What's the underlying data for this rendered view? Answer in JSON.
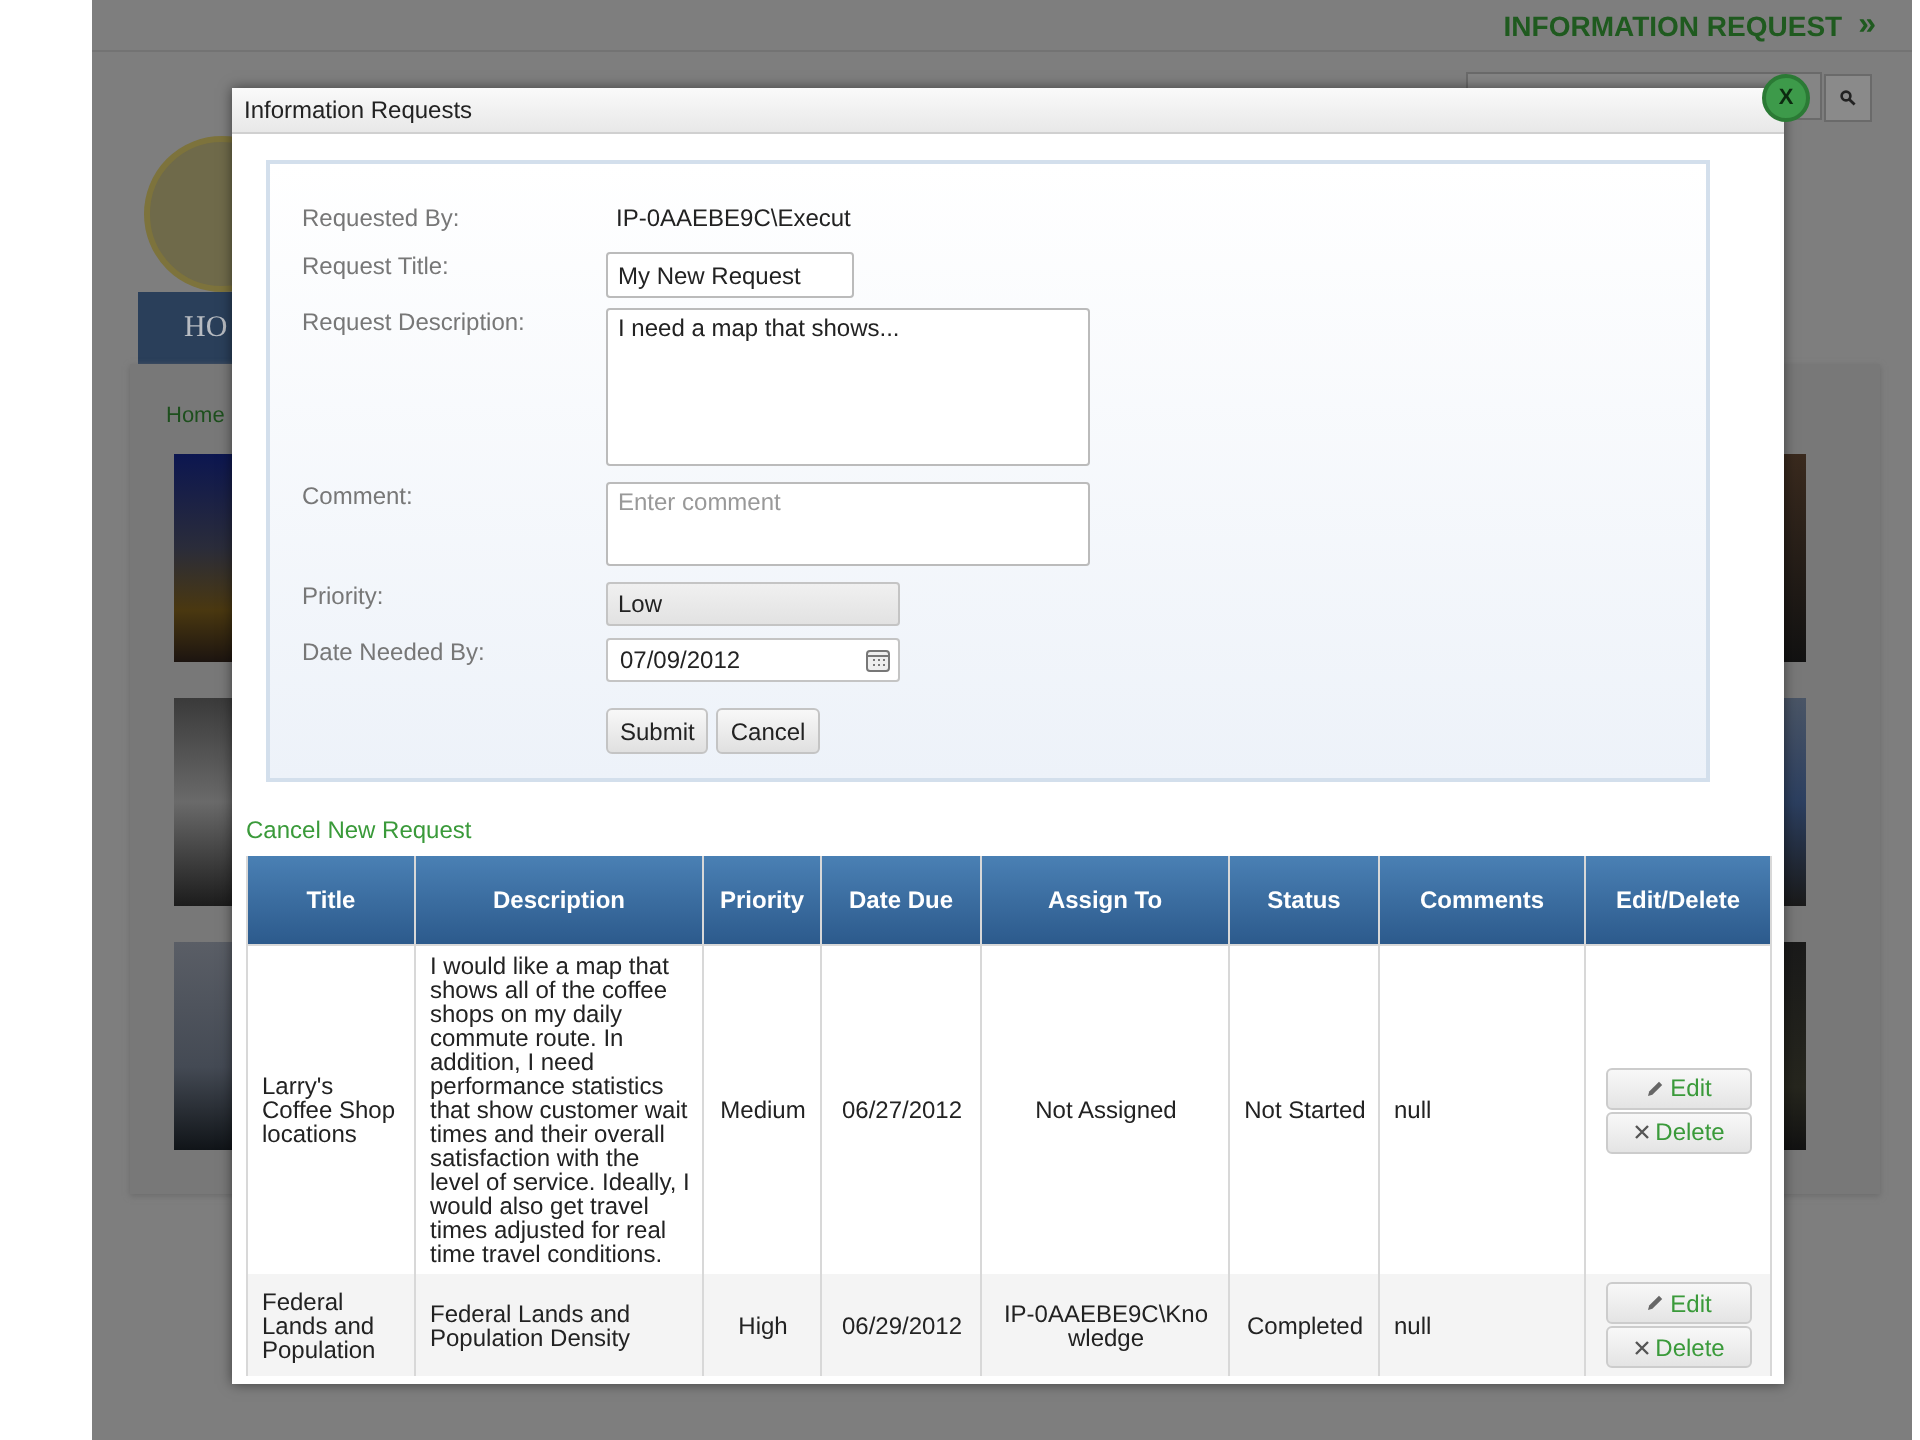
{
  "header": {
    "title": "INFORMATION REQUEST",
    "chevron": "»"
  },
  "nav": {
    "tab": "HO"
  },
  "breadcrumb": "Home",
  "modal": {
    "title": "Information Requests",
    "close": "X",
    "form": {
      "requested_by": {
        "label": "Requested By:",
        "value": "IP-0AAEBE9C\\Execut"
      },
      "request_title": {
        "label": "Request Title:",
        "value": "My New Request"
      },
      "description": {
        "label": "Request Description:",
        "value": "I need a map that shows..."
      },
      "comment": {
        "label": "Comment:",
        "placeholder": "Enter comment"
      },
      "priority": {
        "label": "Priority:",
        "value": "Low"
      },
      "date_needed": {
        "label": "Date Needed By:",
        "value": "07/09/2012"
      },
      "buttons": [
        "Submit",
        "Cancel"
      ]
    },
    "cancel_link": "Cancel New Request",
    "table": {
      "columns": [
        "Title",
        "Description",
        "Priority",
        "Date Due",
        "Assign To",
        "Status",
        "Comments",
        "Edit/Delete"
      ],
      "rows": [
        {
          "title": "Larry's Coffee Shop locations",
          "description": "I would like a map that shows all of the coffee shops on my daily commute route. In addition, I need performance statistics that show customer wait times and their overall satisfaction with the level of service. Ideally, I would also get travel times adjusted for real time travel conditions.",
          "priority": "Medium",
          "date_due": "06/27/2012",
          "assign_to": "Not Assigned",
          "status": "Not Started",
          "comments": "null",
          "actions": [
            "Edit",
            "Delete"
          ]
        },
        {
          "title": "Federal Lands and Population",
          "description": "Federal Lands and Population Density",
          "priority": "High",
          "date_due": "06/29/2012",
          "assign_to": "IP-0AAEBE9C\\Knowledge",
          "status": "Completed",
          "comments": "null",
          "actions": [
            "Edit",
            "Delete"
          ]
        }
      ]
    }
  }
}
